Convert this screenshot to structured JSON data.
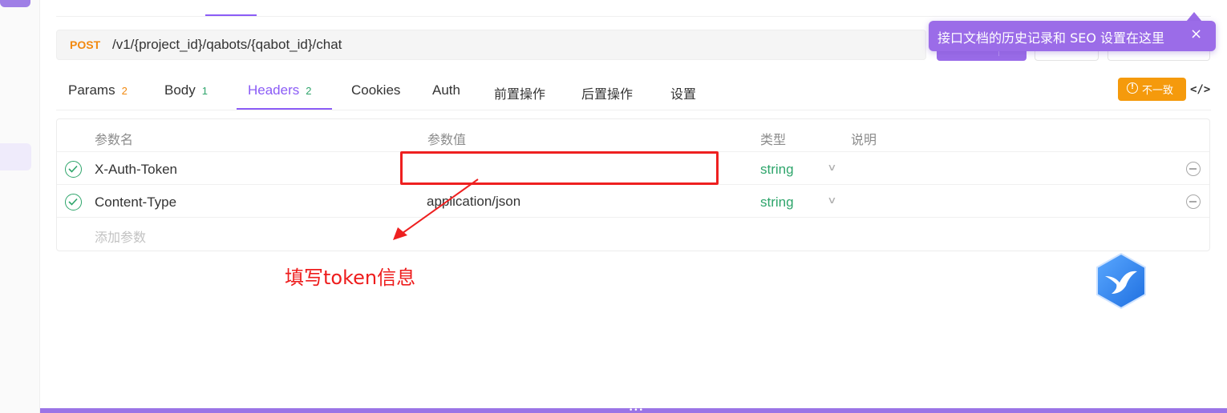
{
  "request": {
    "method": "POST",
    "path": "/v1/{project_id}/qabots/{qabot_id}/chat"
  },
  "tooltip": {
    "text": "接口文档的历史记录和 SEO 设置在这里",
    "close_icon": "×"
  },
  "tabs": [
    {
      "label": "Params",
      "count": "2"
    },
    {
      "label": "Body",
      "count": "1"
    },
    {
      "label": "Headers",
      "count": "2",
      "active": true
    },
    {
      "label": "Cookies"
    },
    {
      "label": "Auth"
    },
    {
      "label": "前置操作"
    },
    {
      "label": "后置操作"
    },
    {
      "label": "设置"
    }
  ],
  "mismatch_badge": {
    "icon": "!",
    "label": "不一致"
  },
  "code_icon": "</>",
  "table": {
    "headers": {
      "name": "参数名",
      "value": "参数值",
      "type": "类型",
      "desc": "说明"
    },
    "rows": [
      {
        "name": "X-Auth-Token",
        "value": "",
        "type": "string"
      },
      {
        "name": "Content-Type",
        "value": "application/json",
        "type": "string"
      }
    ],
    "add_placeholder": "添加参数"
  },
  "annotation": {
    "text": "填写token信息",
    "color": "#ee1c1c"
  },
  "colors": {
    "accent": "#8b5cf6",
    "method": "#f2890f",
    "type_green": "#2ea56b",
    "warning": "#f59a0c"
  }
}
